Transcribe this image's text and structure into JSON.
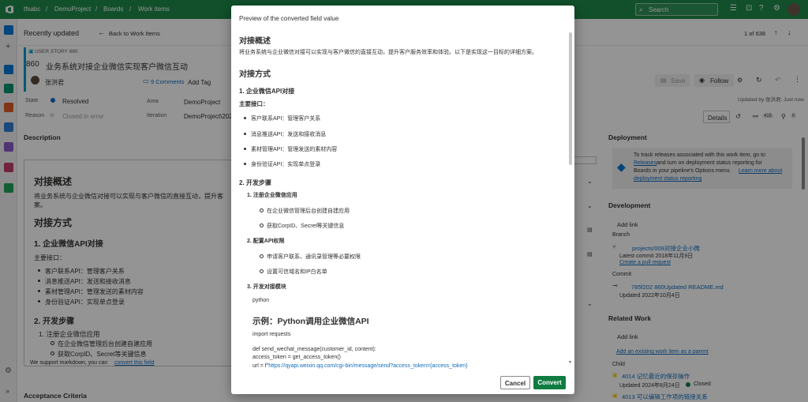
{
  "topbar": {
    "org": "tfsabc",
    "project": "DemoProject",
    "boards": "Boards",
    "work_items": "Work items",
    "search_placeholder": "Search"
  },
  "toolbar": {
    "recently_updated": "Recently updated",
    "back_label": "Back to Work Items",
    "pager": "1 of 638"
  },
  "workitem": {
    "type_label": "USER STORY 860",
    "id": "860",
    "title": "业务系统对接企业微信实现客户微信互动",
    "assignee": "张洪君",
    "comments": "9 Comments",
    "add_tag": "Add Tag",
    "save": "Save",
    "follow": "Follow",
    "updated_by": "Updated by 张洪君: Just now",
    "state_label": "State",
    "state_value": "Resolved",
    "reason_label": "Reason",
    "reason_value": "Closed in error",
    "area_label": "Area",
    "area_value": "DemoProject",
    "iteration_label": "Iteration",
    "iteration_value": "DemoProject\\2022",
    "tab_details": "Details",
    "links_count": "415",
    "attach_count": "0"
  },
  "description": {
    "header": "Description",
    "h1": "对接概述",
    "p1": "将业务系统与企业微信对接可以实现与客户微信的直接互动，提升客",
    "p1b": "案。",
    "h2": "对接方式",
    "h3": "1. 企业微信API对接",
    "main_if": "主要接口：",
    "items": [
      "客户联系API：管理客户关系",
      "消息推送API：发送和接收消息",
      "素材管理API：管理发送的素材内容",
      "身份验证API：实现单点登录"
    ],
    "h3b": "2. 开发步骤",
    "sub1": "1. 注册企业微信应用",
    "sub1_items": [
      "在企业微信管理后台创建自建应用",
      "获取CorpID、Secret等关键信息"
    ],
    "markdown_note": "We support markdown, you can",
    "convert_link": "convert this field",
    "acceptance": "Acceptance Criteria"
  },
  "deployment": {
    "header": "Deployment",
    "text1": "To track releases associated with this work item, go to",
    "releases": "Releases",
    "text2": "and turn on deployment status reporting for",
    "text3": "Boards in your pipeline's Options menu.",
    "learn": "Learn more about",
    "learn2": "deployment status reporting"
  },
  "development": {
    "header": "Development",
    "add_link": "Add link",
    "branch_label": "Branch",
    "branch_name": "projects/009对接企业小微",
    "branch_commit": "Latest commit 2018年11月9日",
    "create_pr": "Create a pull request",
    "commit_label": "Commit",
    "commit_name": "785f202 860Updated README.md",
    "commit_date": "Updated 2022年10月4日"
  },
  "related": {
    "header": "Related Work",
    "add_link": "Add link",
    "add_existing": "Add an existing work item as a parent",
    "child_label": "Child",
    "child1": "4014 记忆最近的保存操作",
    "child1_meta": "Updated 2024年8月24日",
    "child1_state": "Closed",
    "child2": "4013 可以编辑工作项的链接关系"
  },
  "modal": {
    "title": "Preview of the converted field value",
    "h1": "对接概述",
    "p1": "将业务系统与企业微信对接可以实现与客户微信的直接互动，提升客户服务效率和体验。以下是实现这一目标的详细方案。",
    "h2": "对接方式",
    "sec1": "1. 企业微信API对接",
    "main_if": "主要接口：",
    "api_items": [
      "客户联系API：管理客户关系",
      "消息推送API：发送和接收消息",
      "素材管理API：管理发送的素材内容",
      "身份验证API：实现单点登录"
    ],
    "sec2": "2. 开发步骤",
    "step1": "1. 注册企业微信应用",
    "step1_items": [
      "在企业微信管理后台创建自建应用",
      "获取CorpID、Secret等关键信息"
    ],
    "step2": "2. 配置API权限",
    "step2_items": [
      "申请客户联系、通讯录管理等必要权限",
      "设置可信域名和IP白名单"
    ],
    "step3": "3. 开发对接模块",
    "python": "python",
    "example_h": "示例：Python调用企业微信API",
    "import": "import requests",
    "code1": "def send_wechat_message(customer_id, content):",
    "code2": "access_token = get_access_token()",
    "code3_pre": "url = f\"",
    "code3_link": "https://qyapi.weixin.qq.com/cgi-bin/message/send?access_token={access_token}",
    "cancel": "Cancel",
    "convert": "Convert"
  },
  "colors": {
    "topbar": "#1e8a4a",
    "primary": "#107c41",
    "link": "#0f6cbd",
    "state_dot": "#0f6cbd"
  }
}
